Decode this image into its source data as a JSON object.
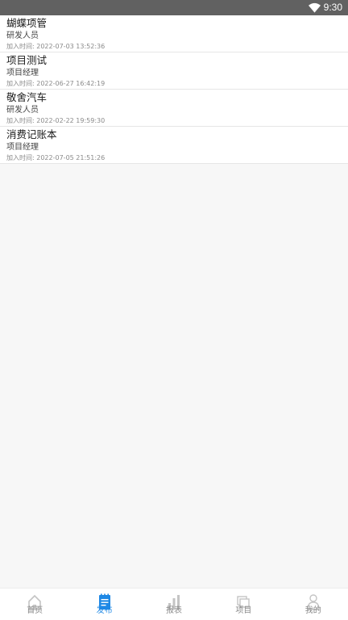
{
  "status_bar": {
    "time": "9:30",
    "wifi_icon": "wifi-icon"
  },
  "projects": [
    {
      "name": "蝴蝶项管",
      "role": "研发人员",
      "added_label": "加入时间:",
      "added_time": "2022-07-03 13:52:36"
    },
    {
      "name": "项目测试",
      "role": "项目经理",
      "added_label": "加入时间:",
      "added_time": "2022-06-27 16:42:19"
    },
    {
      "name": "敬舍汽车",
      "role": "研发人员",
      "added_label": "加入时间:",
      "added_time": "2022-02-22 19:59:30"
    },
    {
      "name": "消费记账本",
      "role": "项目经理",
      "added_label": "加入时间:",
      "added_time": "2022-07-05 21:51:26"
    }
  ],
  "tabs": [
    {
      "label": "首页",
      "icon": "home-icon",
      "active": false
    },
    {
      "label": "发布",
      "icon": "notepad-icon",
      "active": true
    },
    {
      "label": "报表",
      "icon": "bar-chart-icon",
      "active": false
    },
    {
      "label": "项目",
      "icon": "folders-icon",
      "active": false
    },
    {
      "label": "我的",
      "icon": "person-icon",
      "active": false
    }
  ],
  "colors": {
    "active_tab": "#1e88e5",
    "inactive_tab": "#8a8a8a",
    "status_bar": "#616161"
  }
}
